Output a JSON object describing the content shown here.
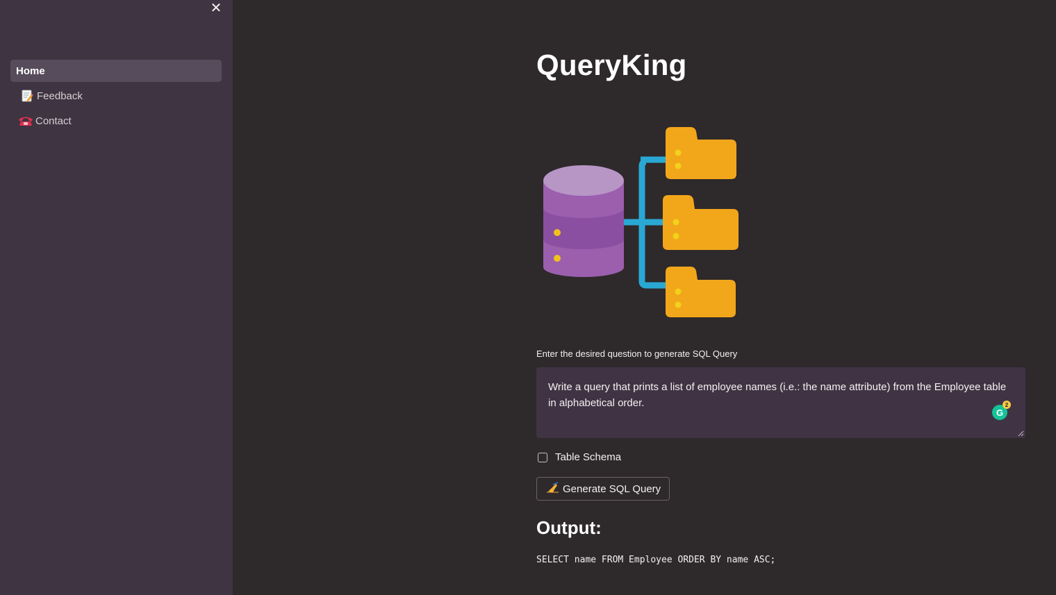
{
  "sidebar": {
    "close_label": "✕",
    "items": [
      {
        "label": "Home",
        "icon": ""
      },
      {
        "label": "Feedback",
        "icon": "memo-icon"
      },
      {
        "label": "Contact",
        "icon": "telephone-icon"
      }
    ]
  },
  "main": {
    "title": "QueryKing",
    "question_label": "Enter the desired question to generate SQL Query",
    "question_value": "Write a query that prints a list of employee names (i.e.: the name attribute) from the Employee table in alphabetical order.",
    "grammarly_count": "2",
    "checkbox_label": "Table Schema",
    "button_label": "Generate SQL Query",
    "button_icon": "writing-hand-icon",
    "output_heading": "Output:",
    "output_code": "SELECT name FROM Employee ORDER BY name ASC;"
  },
  "colors": {
    "sidebar_bg": "#3f3442",
    "main_bg": "#2e292b",
    "accent_purple": "#9b59b6",
    "accent_folder": "#f2a71b",
    "accent_connector": "#2aa8d4"
  }
}
